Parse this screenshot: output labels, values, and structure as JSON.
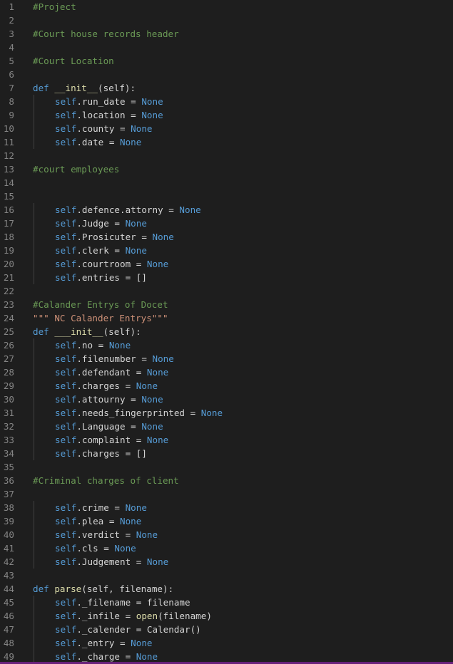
{
  "editor": {
    "language": "python",
    "colors": {
      "background": "#1e1e1e",
      "line_number": "#858585",
      "comment": "#6a9955",
      "keyword": "#569cd6",
      "function": "#dcdcaa",
      "string": "#ce9178",
      "text": "#d4d4d4",
      "status_bar": "#68217a"
    },
    "lines": [
      {
        "n": "1",
        "indent": 0,
        "tokens": [
          {
            "t": "#Project",
            "c": "comment"
          }
        ]
      },
      {
        "n": "2",
        "indent": 0,
        "tokens": []
      },
      {
        "n": "3",
        "indent": 0,
        "tokens": [
          {
            "t": "#Court house records header",
            "c": "comment"
          }
        ]
      },
      {
        "n": "4",
        "indent": 0,
        "tokens": []
      },
      {
        "n": "5",
        "indent": 0,
        "tokens": [
          {
            "t": "#Court Location",
            "c": "comment"
          }
        ]
      },
      {
        "n": "6",
        "indent": 0,
        "tokens": []
      },
      {
        "n": "7",
        "indent": 0,
        "tokens": [
          {
            "t": "def",
            "c": "kw"
          },
          {
            "t": " ",
            "c": "plain"
          },
          {
            "t": "__init__",
            "c": "fn"
          },
          {
            "t": "(self):",
            "c": "plain"
          }
        ]
      },
      {
        "n": "8",
        "indent": 1,
        "tokens": [
          {
            "t": "self",
            "c": "self"
          },
          {
            "t": ".run_date = ",
            "c": "plain"
          },
          {
            "t": "None",
            "c": "none"
          }
        ]
      },
      {
        "n": "9",
        "indent": 1,
        "tokens": [
          {
            "t": "self",
            "c": "self"
          },
          {
            "t": ".location = ",
            "c": "plain"
          },
          {
            "t": "None",
            "c": "none"
          }
        ]
      },
      {
        "n": "10",
        "indent": 1,
        "tokens": [
          {
            "t": "self",
            "c": "self"
          },
          {
            "t": ".county = ",
            "c": "plain"
          },
          {
            "t": "None",
            "c": "none"
          }
        ]
      },
      {
        "n": "11",
        "indent": 1,
        "tokens": [
          {
            "t": "self",
            "c": "self"
          },
          {
            "t": ".date = ",
            "c": "plain"
          },
          {
            "t": "None",
            "c": "none"
          }
        ]
      },
      {
        "n": "12",
        "indent": 0,
        "tokens": []
      },
      {
        "n": "13",
        "indent": 0,
        "tokens": [
          {
            "t": "#court employees",
            "c": "comment"
          }
        ]
      },
      {
        "n": "14",
        "indent": 0,
        "tokens": []
      },
      {
        "n": "15",
        "indent": 0,
        "tokens": []
      },
      {
        "n": "16",
        "indent": 1,
        "tokens": [
          {
            "t": "self",
            "c": "self"
          },
          {
            "t": ".defence.attorny = ",
            "c": "plain"
          },
          {
            "t": "None",
            "c": "none"
          }
        ]
      },
      {
        "n": "17",
        "indent": 1,
        "tokens": [
          {
            "t": "self",
            "c": "self"
          },
          {
            "t": ".Judge = ",
            "c": "plain"
          },
          {
            "t": "None",
            "c": "none"
          }
        ]
      },
      {
        "n": "18",
        "indent": 1,
        "tokens": [
          {
            "t": "self",
            "c": "self"
          },
          {
            "t": ".Prosicuter = ",
            "c": "plain"
          },
          {
            "t": "None",
            "c": "none"
          }
        ]
      },
      {
        "n": "19",
        "indent": 1,
        "tokens": [
          {
            "t": "self",
            "c": "self"
          },
          {
            "t": ".clerk = ",
            "c": "plain"
          },
          {
            "t": "None",
            "c": "none"
          }
        ]
      },
      {
        "n": "20",
        "indent": 1,
        "tokens": [
          {
            "t": "self",
            "c": "self"
          },
          {
            "t": ".courtroom = ",
            "c": "plain"
          },
          {
            "t": "None",
            "c": "none"
          }
        ]
      },
      {
        "n": "21",
        "indent": 1,
        "tokens": [
          {
            "t": "self",
            "c": "self"
          },
          {
            "t": ".entries = []",
            "c": "plain"
          }
        ]
      },
      {
        "n": "22",
        "indent": 0,
        "tokens": []
      },
      {
        "n": "23",
        "indent": 0,
        "tokens": [
          {
            "t": "#Calander Entrys of Docet",
            "c": "comment"
          }
        ]
      },
      {
        "n": "24",
        "indent": 0,
        "tokens": [
          {
            "t": "\"\"\" NC Calander Entrys\"\"\"",
            "c": "str"
          }
        ]
      },
      {
        "n": "25",
        "indent": 0,
        "tokens": [
          {
            "t": "def",
            "c": "kw"
          },
          {
            "t": " ",
            "c": "plain"
          },
          {
            "t": "___init__",
            "c": "fn"
          },
          {
            "t": "(self):",
            "c": "plain"
          }
        ]
      },
      {
        "n": "26",
        "indent": 1,
        "tokens": [
          {
            "t": "self",
            "c": "self"
          },
          {
            "t": ".no = ",
            "c": "plain"
          },
          {
            "t": "None",
            "c": "none"
          }
        ]
      },
      {
        "n": "27",
        "indent": 1,
        "tokens": [
          {
            "t": "self",
            "c": "self"
          },
          {
            "t": ".filenumber = ",
            "c": "plain"
          },
          {
            "t": "None",
            "c": "none"
          }
        ]
      },
      {
        "n": "28",
        "indent": 1,
        "tokens": [
          {
            "t": "self",
            "c": "self"
          },
          {
            "t": ".defendant = ",
            "c": "plain"
          },
          {
            "t": "None",
            "c": "none"
          }
        ]
      },
      {
        "n": "29",
        "indent": 1,
        "tokens": [
          {
            "t": "self",
            "c": "self"
          },
          {
            "t": ".charges = ",
            "c": "plain"
          },
          {
            "t": "None",
            "c": "none"
          }
        ]
      },
      {
        "n": "30",
        "indent": 1,
        "tokens": [
          {
            "t": "self",
            "c": "self"
          },
          {
            "t": ".attourny = ",
            "c": "plain"
          },
          {
            "t": "None",
            "c": "none"
          }
        ]
      },
      {
        "n": "31",
        "indent": 1,
        "tokens": [
          {
            "t": "self",
            "c": "self"
          },
          {
            "t": ".needs_fingerprinted = ",
            "c": "plain"
          },
          {
            "t": "None",
            "c": "none"
          }
        ]
      },
      {
        "n": "32",
        "indent": 1,
        "tokens": [
          {
            "t": "self",
            "c": "self"
          },
          {
            "t": ".Language = ",
            "c": "plain"
          },
          {
            "t": "None",
            "c": "none"
          }
        ]
      },
      {
        "n": "33",
        "indent": 1,
        "tokens": [
          {
            "t": "self",
            "c": "self"
          },
          {
            "t": ".complaint = ",
            "c": "plain"
          },
          {
            "t": "None",
            "c": "none"
          }
        ]
      },
      {
        "n": "34",
        "indent": 1,
        "tokens": [
          {
            "t": "self",
            "c": "self"
          },
          {
            "t": ".charges = []",
            "c": "plain"
          }
        ]
      },
      {
        "n": "35",
        "indent": 0,
        "tokens": []
      },
      {
        "n": "36",
        "indent": 0,
        "tokens": [
          {
            "t": "#Criminal charges of client",
            "c": "comment"
          }
        ]
      },
      {
        "n": "37",
        "indent": 0,
        "tokens": []
      },
      {
        "n": "38",
        "indent": 1,
        "tokens": [
          {
            "t": "self",
            "c": "self"
          },
          {
            "t": ".crime = ",
            "c": "plain"
          },
          {
            "t": "None",
            "c": "none"
          }
        ]
      },
      {
        "n": "39",
        "indent": 1,
        "tokens": [
          {
            "t": "self",
            "c": "self"
          },
          {
            "t": ".plea = ",
            "c": "plain"
          },
          {
            "t": "None",
            "c": "none"
          }
        ]
      },
      {
        "n": "40",
        "indent": 1,
        "tokens": [
          {
            "t": "self",
            "c": "self"
          },
          {
            "t": ".verdict = ",
            "c": "plain"
          },
          {
            "t": "None",
            "c": "none"
          }
        ]
      },
      {
        "n": "41",
        "indent": 1,
        "tokens": [
          {
            "t": "self",
            "c": "self"
          },
          {
            "t": ".cls = ",
            "c": "plain"
          },
          {
            "t": "None",
            "c": "none"
          }
        ]
      },
      {
        "n": "42",
        "indent": 1,
        "tokens": [
          {
            "t": "self",
            "c": "self"
          },
          {
            "t": ".Judgement = ",
            "c": "plain"
          },
          {
            "t": "None",
            "c": "none"
          }
        ]
      },
      {
        "n": "43",
        "indent": 0,
        "tokens": []
      },
      {
        "n": "44",
        "indent": 0,
        "tokens": [
          {
            "t": "def",
            "c": "kw"
          },
          {
            "t": " ",
            "c": "plain"
          },
          {
            "t": "parse",
            "c": "fn"
          },
          {
            "t": "(self, filename):",
            "c": "plain"
          }
        ]
      },
      {
        "n": "45",
        "indent": 1,
        "tokens": [
          {
            "t": "self",
            "c": "self"
          },
          {
            "t": "._filename = filename",
            "c": "plain"
          }
        ]
      },
      {
        "n": "46",
        "indent": 1,
        "tokens": [
          {
            "t": "self",
            "c": "self"
          },
          {
            "t": "._infile = ",
            "c": "plain"
          },
          {
            "t": "open",
            "c": "fn"
          },
          {
            "t": "(filename)",
            "c": "plain"
          }
        ]
      },
      {
        "n": "47",
        "indent": 1,
        "tokens": [
          {
            "t": "self",
            "c": "self"
          },
          {
            "t": "._calender = Calendar()",
            "c": "plain"
          }
        ]
      },
      {
        "n": "48",
        "indent": 1,
        "tokens": [
          {
            "t": "self",
            "c": "self"
          },
          {
            "t": "._entry = ",
            "c": "plain"
          },
          {
            "t": "None",
            "c": "none"
          }
        ]
      },
      {
        "n": "49",
        "indent": 1,
        "tokens": [
          {
            "t": "self",
            "c": "self"
          },
          {
            "t": "._charge = ",
            "c": "plain"
          },
          {
            "t": "None",
            "c": "none"
          }
        ]
      }
    ]
  }
}
